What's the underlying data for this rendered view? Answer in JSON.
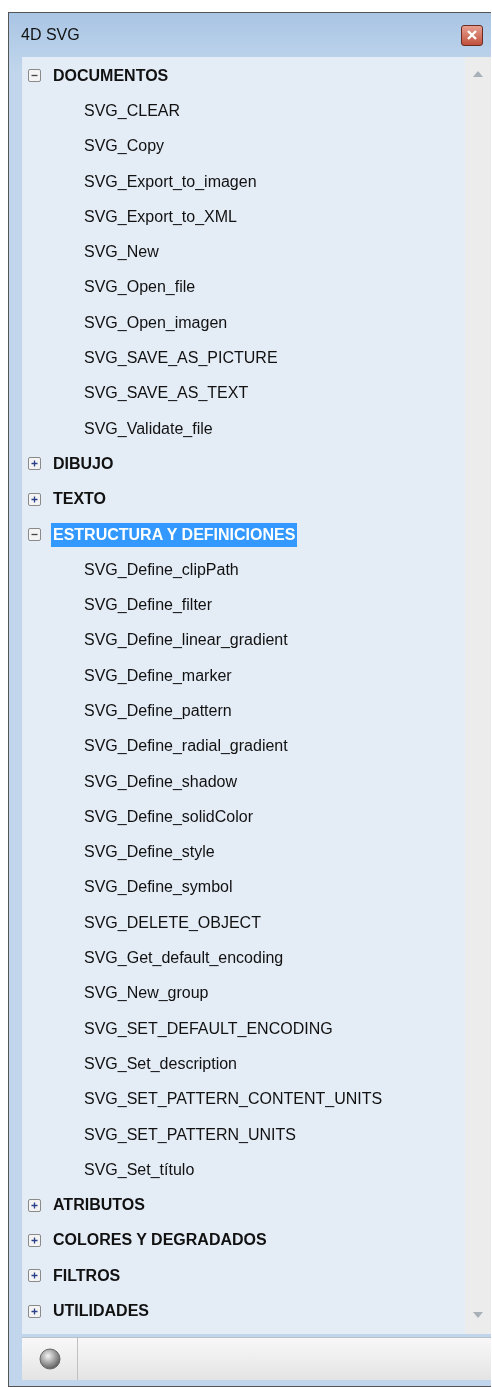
{
  "window": {
    "title": "4D SVG"
  },
  "tree": [
    {
      "label": "DOCUMENTOS",
      "expanded": true,
      "selected": false,
      "children": [
        {
          "label": "SVG_CLEAR",
          "selected": false
        },
        {
          "label": "SVG_Copy",
          "selected": false
        },
        {
          "label": "SVG_Export_to_imagen",
          "selected": false
        },
        {
          "label": "SVG_Export_to_XML",
          "selected": false
        },
        {
          "label": "SVG_New",
          "selected": false
        },
        {
          "label": "SVG_Open_file",
          "selected": false
        },
        {
          "label": "SVG_Open_imagen",
          "selected": false
        },
        {
          "label": "SVG_SAVE_AS_PICTURE",
          "selected": false
        },
        {
          "label": "SVG_SAVE_AS_TEXT",
          "selected": false
        },
        {
          "label": "SVG_Validate_file",
          "selected": false
        }
      ]
    },
    {
      "label": "DIBUJO",
      "expanded": false,
      "selected": false
    },
    {
      "label": "TEXTO",
      "expanded": false,
      "selected": false
    },
    {
      "label": "ESTRUCTURA Y DEFINICIONES",
      "expanded": true,
      "selected": true,
      "children": [
        {
          "label": "SVG_Define_clipPath",
          "selected": false
        },
        {
          "label": "SVG_Define_filter",
          "selected": false
        },
        {
          "label": "SVG_Define_linear_gradient",
          "selected": false
        },
        {
          "label": "SVG_Define_marker",
          "selected": false
        },
        {
          "label": "SVG_Define_pattern",
          "selected": false
        },
        {
          "label": "SVG_Define_radial_gradient",
          "selected": false
        },
        {
          "label": "SVG_Define_shadow",
          "selected": false
        },
        {
          "label": "SVG_Define_solidColor",
          "selected": false
        },
        {
          "label": "SVG_Define_style",
          "selected": false
        },
        {
          "label": "SVG_Define_symbol",
          "selected": false
        },
        {
          "label": "SVG_DELETE_OBJECT",
          "selected": false
        },
        {
          "label": "SVG_Get_default_encoding",
          "selected": false
        },
        {
          "label": "SVG_New_group",
          "selected": false
        },
        {
          "label": "SVG_SET_DEFAULT_ENCODING",
          "selected": false
        },
        {
          "label": "SVG_Set_description",
          "selected": false
        },
        {
          "label": "SVG_SET_PATTERN_CONTENT_UNITS",
          "selected": false
        },
        {
          "label": "SVG_SET_PATTERN_UNITS",
          "selected": false
        },
        {
          "label": "SVG_Set_título",
          "selected": false
        }
      ]
    },
    {
      "label": "ATRIBUTOS",
      "expanded": false,
      "selected": false
    },
    {
      "label": "COLORES Y DEGRADADOS",
      "expanded": false,
      "selected": false
    },
    {
      "label": "FILTROS",
      "expanded": false,
      "selected": false
    },
    {
      "label": "UTILIDADES",
      "expanded": false,
      "selected": false
    }
  ]
}
